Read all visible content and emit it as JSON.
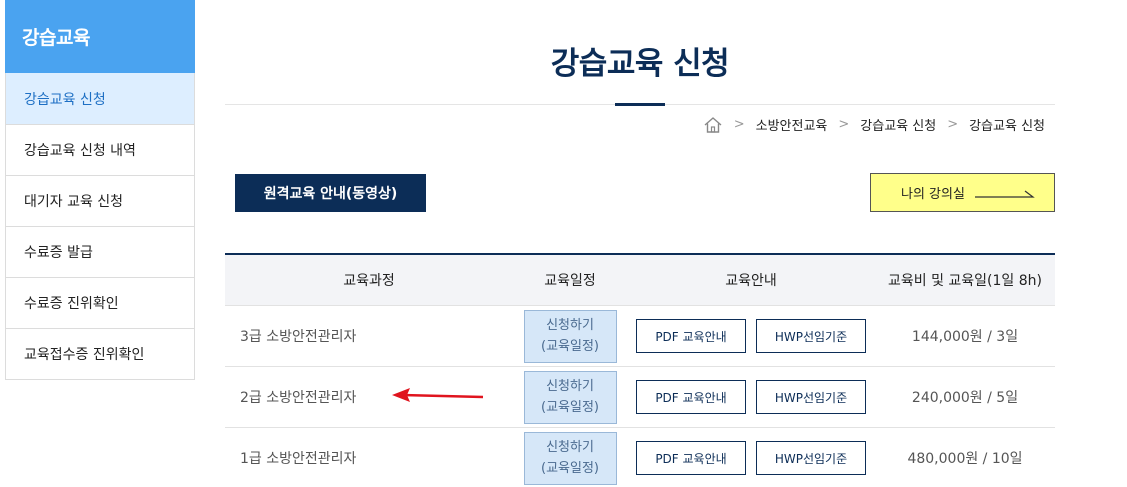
{
  "sidebar": {
    "title": "강습교육",
    "items": [
      {
        "label": "강습교육 신청"
      },
      {
        "label": "강습교육 신청 내역"
      },
      {
        "label": "대기자 교육 신청"
      },
      {
        "label": "수료증 발급"
      },
      {
        "label": "수료증 진위확인"
      },
      {
        "label": "교육접수증 진위확인"
      }
    ]
  },
  "page": {
    "title": "강습교육 신청",
    "breadcrumb": [
      "소방안전교육",
      "강습교육 신청",
      "강습교육 신청"
    ]
  },
  "buttons": {
    "remote_guide": "원격교육 안내(동영상)",
    "my_lecture": "나의 강의실"
  },
  "table": {
    "headers": [
      "교육과정",
      "교육일정",
      "교육안내",
      "교육비 및 교육일(1일 8h)"
    ],
    "apply_line1": "신청하기",
    "apply_line2": "(교육일정)",
    "pdf_label": "PDF 교육안내",
    "hwp_label": "HWP선임기준",
    "rows": [
      {
        "course": "3급 소방안전관리자",
        "fee": "144,000원 / 3일"
      },
      {
        "course": "2급 소방안전관리자",
        "fee": "240,000원 / 5일"
      },
      {
        "course": "1급 소방안전관리자",
        "fee": "480,000원 / 10일"
      }
    ]
  },
  "colors": {
    "sidebar_header": "#4aa3f0",
    "navy": "#0c2d57",
    "lecture_button": "#ffff8a",
    "annotation_arrow": "#e0141e"
  }
}
